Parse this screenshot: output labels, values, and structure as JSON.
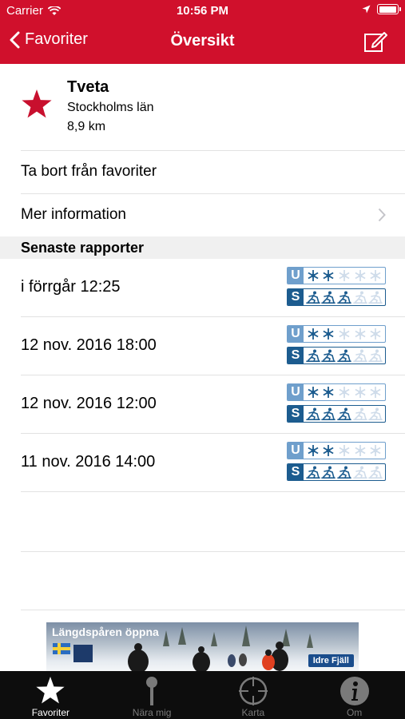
{
  "status_bar": {
    "carrier": "Carrier",
    "time": "10:56 PM"
  },
  "nav": {
    "back_label": "Favoriter",
    "title": "Översikt"
  },
  "favorite": {
    "name": "Tveta",
    "region": "Stockholms län",
    "distance": "8,9 km"
  },
  "actions": {
    "remove_favorite": "Ta bort från favoriter",
    "more_info": "Mer information"
  },
  "section_title": "Senaste rapporter",
  "reports": [
    {
      "date": "i förrgår 12:25",
      "u_level": 2,
      "s_level": 3
    },
    {
      "date": "12 nov. 2016 18:00",
      "u_level": 2,
      "s_level": 3
    },
    {
      "date": "12 nov. 2016 12:00",
      "u_level": 2,
      "s_level": 3
    },
    {
      "date": "11 nov. 2016 14:00",
      "u_level": 2,
      "s_level": 3
    }
  ],
  "gauge_labels": {
    "u": "U",
    "s": "S"
  },
  "ad": {
    "headline": "Längdspåren öppna",
    "brand": "Idre Fjäll"
  },
  "tabs": [
    {
      "label": "Favoriter",
      "icon": "star-icon",
      "active": true
    },
    {
      "label": "Nära mig",
      "icon": "location-pin-icon",
      "active": false
    },
    {
      "label": "Karta",
      "icon": "crosshair-icon",
      "active": false
    },
    {
      "label": "Om",
      "icon": "info-icon",
      "active": false
    }
  ],
  "colors": {
    "header": "#d0102c",
    "star": "#c8102e",
    "gauge_u": "#6f9fcc",
    "gauge_s": "#1c5c8f",
    "gauge_inactive": "#cfdcea",
    "tabbar": "#0d0d0d"
  }
}
